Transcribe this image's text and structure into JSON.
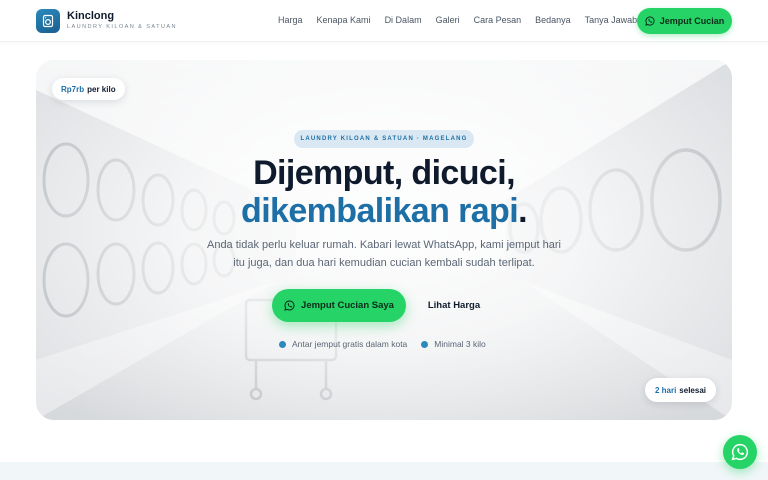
{
  "brand": {
    "name": "Kinclong",
    "tagline": "LAUNDRY KILOAN & SATUAN",
    "logo_icon": "washing-machine-icon"
  },
  "nav": {
    "items": [
      "Harga",
      "Kenapa Kami",
      "Di Dalam",
      "Galeri",
      "Cara Pesan",
      "Bedanya",
      "Tanya Jawab"
    ],
    "cta_label": "Jemput Cucian",
    "cta_icon": "whatsapp-icon"
  },
  "hero": {
    "price_badge": {
      "amount": "Rp7rb",
      "unit": "per kilo"
    },
    "eyebrow": "LAUNDRY KILOAN & SATUAN · MAGELANG",
    "headline_line1": "Dijemput, dicuci,",
    "headline_line2": "dikembalikan rapi",
    "headline_punct": ".",
    "lead": "Anda tidak perlu keluar rumah. Kabari lewat WhatsApp, kami jemput hari itu juga, dan dua hari kemudian cucian kembali sudah terlipat.",
    "primary_button": "Jemput Cucian Saya",
    "secondary_button": "Lihat Harga",
    "bullets": [
      "Antar jemput gratis dalam kota",
      "Minimal 3 kilo"
    ],
    "days_badge": {
      "amount": "2 hari",
      "unit": "selesai"
    }
  },
  "floating": {
    "icon": "whatsapp-icon"
  },
  "colors": {
    "brand_blue": "#1d6fa5",
    "whatsapp_green": "#25d366",
    "ink": "#0f1b2d"
  }
}
